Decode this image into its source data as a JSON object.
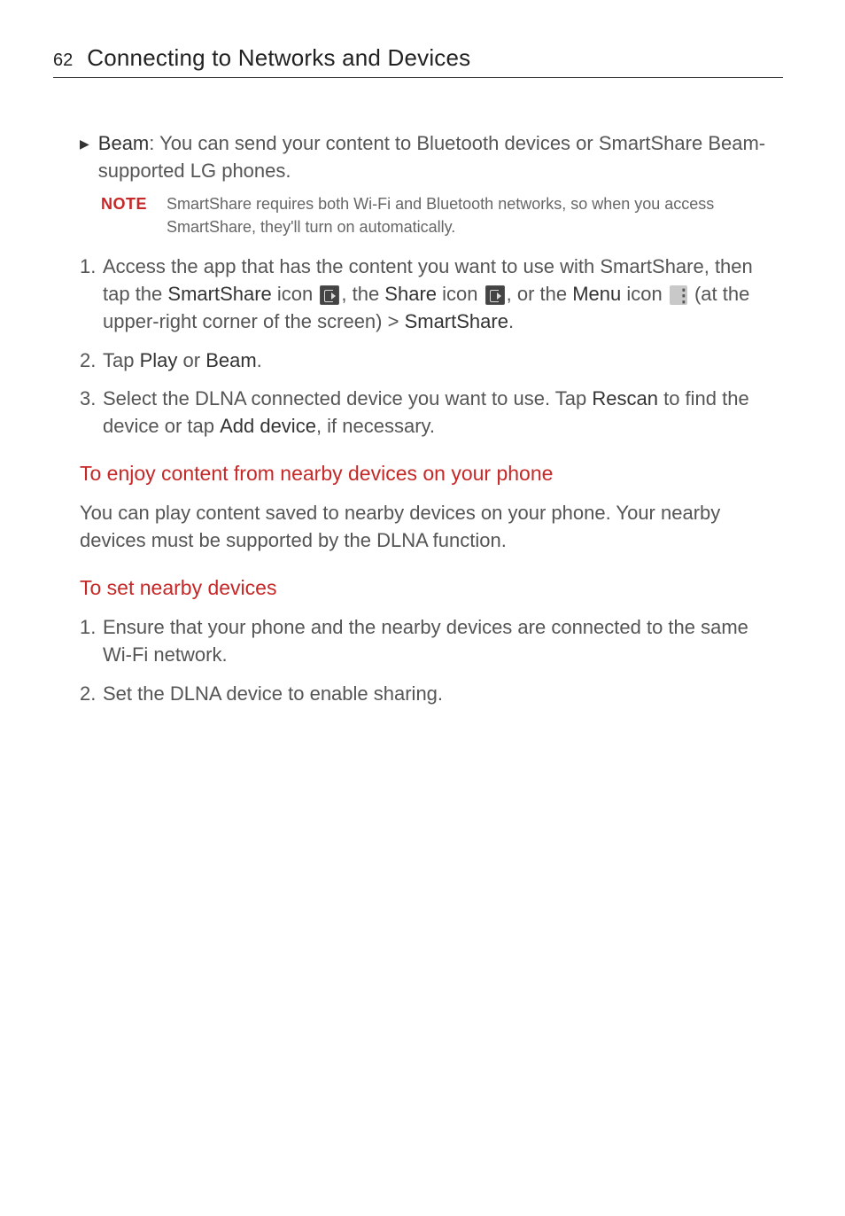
{
  "page_number": "62",
  "header_title": "Connecting to Networks and Devices",
  "beam_bullet": {
    "label": "Beam",
    "text": ": You can send your content to Bluetooth devices or SmartShare Beam-supported LG phones."
  },
  "note": {
    "label": "NOTE",
    "text": "SmartShare requires both Wi-Fi and Bluetooth networks, so when you access SmartShare, they'll turn on automatically."
  },
  "step1": {
    "num": "1.",
    "t1": "Access the app that has the content you want to use with SmartShare, then tap the ",
    "b1": "SmartShare",
    "t2": " icon ",
    "t3": ", the ",
    "b2": "Share",
    "t4": " icon ",
    "t5": ", or the ",
    "b3": "Menu",
    "t6": " icon ",
    "t7": " (at the upper-right corner of the screen) > ",
    "b4": "SmartShare",
    "t8": "."
  },
  "step2": {
    "num": "2.",
    "t1": "Tap ",
    "b1": "Play",
    "t2": " or ",
    "b2": "Beam",
    "t3": "."
  },
  "step3": {
    "num": "3.",
    "t1": "Select the DLNA connected device you want to use. Tap ",
    "b1": "Rescan",
    "t2": " to find the device or tap ",
    "b2": "Add device",
    "t3": ", if necessary."
  },
  "heading1": "To enjoy content from nearby devices on your phone",
  "para1": "You can play content saved to nearby devices on your phone. Your nearby devices must be supported by the DLNA function.",
  "heading2": "To set nearby devices",
  "nb_step1": {
    "num": "1.",
    "text": "Ensure that your phone and the nearby devices are connected to the same Wi-Fi network."
  },
  "nb_step2": {
    "num": "2.",
    "text": "Set the DLNA device to enable sharing."
  }
}
